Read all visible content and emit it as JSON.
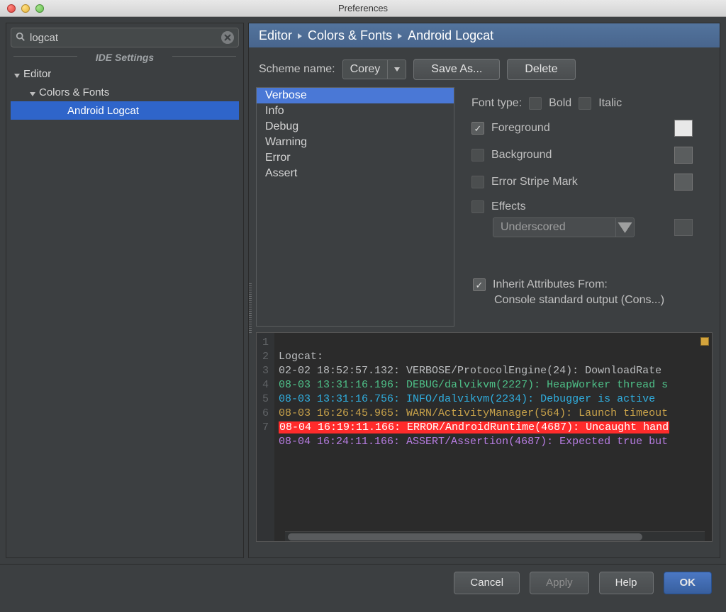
{
  "window": {
    "title": "Preferences"
  },
  "search": {
    "value": "logcat"
  },
  "sidebar": {
    "section_label": "IDE Settings",
    "tree": {
      "editor": "Editor",
      "colors_fonts": "Colors & Fonts",
      "android_logcat": "Android Logcat"
    }
  },
  "breadcrumb": {
    "a": "Editor",
    "b": "Colors & Fonts",
    "c": "Android Logcat"
  },
  "scheme": {
    "label": "Scheme name:",
    "value": "Corey",
    "save_as": "Save As...",
    "delete": "Delete"
  },
  "levels": [
    "Verbose",
    "Info",
    "Debug",
    "Warning",
    "Error",
    "Assert"
  ],
  "font": {
    "label": "Font type:",
    "bold": "Bold",
    "italic": "Italic",
    "foreground": "Foreground",
    "background": "Background",
    "stripe": "Error Stripe Mark",
    "effects": "Effects",
    "effects_value": "Underscored",
    "inherit": "Inherit Attributes From:",
    "inherit_sub": "Console standard output (Cons...)"
  },
  "preview": {
    "lines": {
      "n1": "1",
      "n2": "2",
      "n3": "3",
      "n4": "4",
      "n5": "5",
      "n6": "6",
      "n7": "7",
      "l1": "Logcat:",
      "l2": "02-02 18:52:57.132: VERBOSE/ProtocolEngine(24): DownloadRate ",
      "l3": "08-03 13:31:16.196: DEBUG/dalvikvm(2227): HeapWorker thread s",
      "l4": "08-03 13:31:16.756: INFO/dalvikvm(2234): Debugger is active",
      "l5": "08-03 16:26:45.965: WARN/ActivityManager(564): Launch timeout",
      "l6": "08-04 16:19:11.166: ERROR/AndroidRuntime(4687): Uncaught hand",
      "l7": "08-04 16:24:11.166: ASSERT/Assertion(4687): Expected true but"
    }
  },
  "footer": {
    "cancel": "Cancel",
    "apply": "Apply",
    "help": "Help",
    "ok": "OK"
  }
}
